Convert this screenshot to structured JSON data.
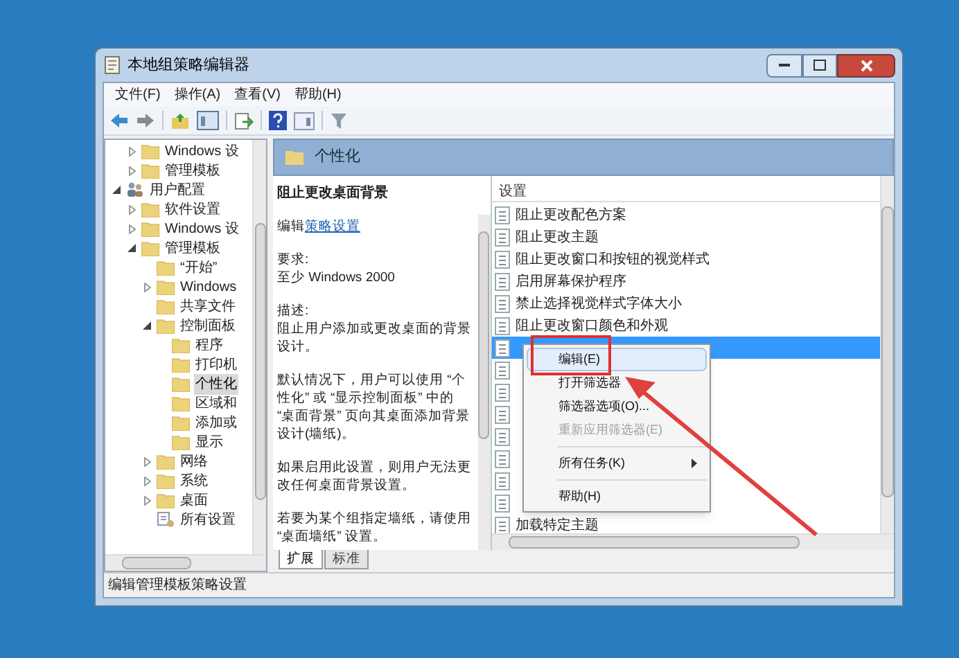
{
  "window": {
    "title": "本地组策略编辑器"
  },
  "menu": [
    "文件(F)",
    "操作(A)",
    "查看(V)",
    "帮助(H)"
  ],
  "tree": [
    {
      "children": [
        {
          "label": "Windows 设",
          "kind": "folder",
          "expanded": false
        },
        {
          "label": "管理模板",
          "kind": "folder",
          "expanded": false
        }
      ]
    },
    {
      "label": "用户配置",
      "kind": "user",
      "expanded": true,
      "children": [
        {
          "label": "软件设置",
          "kind": "folder",
          "expanded": false
        },
        {
          "label": "Windows 设",
          "kind": "folder",
          "expanded": false
        },
        {
          "label": "管理模板",
          "kind": "folder",
          "expanded": true,
          "children": [
            {
              "label": "“开始”",
              "kind": "folder"
            },
            {
              "label": "Windows",
              "kind": "folder",
              "expanded": false
            },
            {
              "label": "共享文件",
              "kind": "folder"
            },
            {
              "label": "控制面板",
              "kind": "folder",
              "expanded": true,
              "children": [
                {
                  "label": "程序",
                  "kind": "folder",
                  "selected": false
                },
                {
                  "label": "打印机",
                  "kind": "folder",
                  "selected": false
                },
                {
                  "label": "个性化",
                  "kind": "folder",
                  "selected": true
                },
                {
                  "label": "区域和",
                  "kind": "folder",
                  "selected": false
                },
                {
                  "label": "添加或",
                  "kind": "folder",
                  "selected": false
                },
                {
                  "label": "显示",
                  "kind": "folder",
                  "selected": false
                }
              ]
            },
            {
              "label": "网络",
              "kind": "folder",
              "expanded": false
            },
            {
              "label": "系统",
              "kind": "folder",
              "expanded": false
            },
            {
              "label": "桌面",
              "kind": "folder",
              "expanded": false
            },
            {
              "label": "所有设置",
              "kind": "settings"
            }
          ]
        }
      ]
    }
  ],
  "header": {
    "title": "个性化"
  },
  "description": {
    "title": "阻止更改桌面背景",
    "edit_prefix": "编辑",
    "edit_link": "策略设置",
    "paragraphs": [
      "要求:\n至少 Windows 2000",
      "描述:\n阻止用户添加或更改桌面的背景设计。",
      "默认情况下，用户可以使用 “个性化” 或 “显示控制面板” 中的 “桌面背景” 页向其桌面添加背景设计(墙纸)。",
      "如果启用此设置，则用户无法更改任何桌面背景设置。",
      "若要为某个组指定墙纸，请使用 “桌面墙纸” 设置。"
    ]
  },
  "tabs": [
    {
      "label": "扩展",
      "selected": true
    },
    {
      "label": "标准",
      "selected": false
    }
  ],
  "settings": {
    "column": "设置",
    "rows": [
      {
        "label": "阻止更改配色方案",
        "selected": false
      },
      {
        "label": "阻止更改主题",
        "selected": false
      },
      {
        "label": "阻止更改窗口和按钮的视觉样式",
        "selected": false
      },
      {
        "label": "启用屏幕保护程序",
        "selected": false
      },
      {
        "label": "禁止选择视觉样式字体大小",
        "selected": false
      },
      {
        "label": "阻止更改窗口颜色和外观",
        "selected": false
      },
      {
        "selected": true
      },
      {
        "selected": false
      },
      {
        "selected": false
      },
      {
        "selected": false
      },
      {
        "selected": false
      },
      {
        "selected": false
      },
      {
        "selected": false
      },
      {
        "selected": false
      },
      {
        "label": "加载特定主题",
        "selected": false
      }
    ]
  },
  "context_menu": [
    {
      "kind": "item",
      "label": "编辑(E)",
      "highlighted": true,
      "disabled": false
    },
    {
      "kind": "item",
      "label": "打开筛选器",
      "highlighted": false,
      "disabled": false
    },
    {
      "kind": "item",
      "label": "筛选器选项(O)...",
      "highlighted": false,
      "disabled": false
    },
    {
      "kind": "item",
      "label": "重新应用筛选器(E)",
      "highlighted": false,
      "disabled": true
    },
    {
      "kind": "separator"
    },
    {
      "kind": "submenu",
      "label": "所有任务(K)",
      "highlighted": false,
      "disabled": false
    },
    {
      "kind": "separator"
    },
    {
      "kind": "item",
      "label": "帮助(H)",
      "highlighted": false,
      "disabled": false
    }
  ],
  "status_bar": "编辑管理模板策略设置"
}
